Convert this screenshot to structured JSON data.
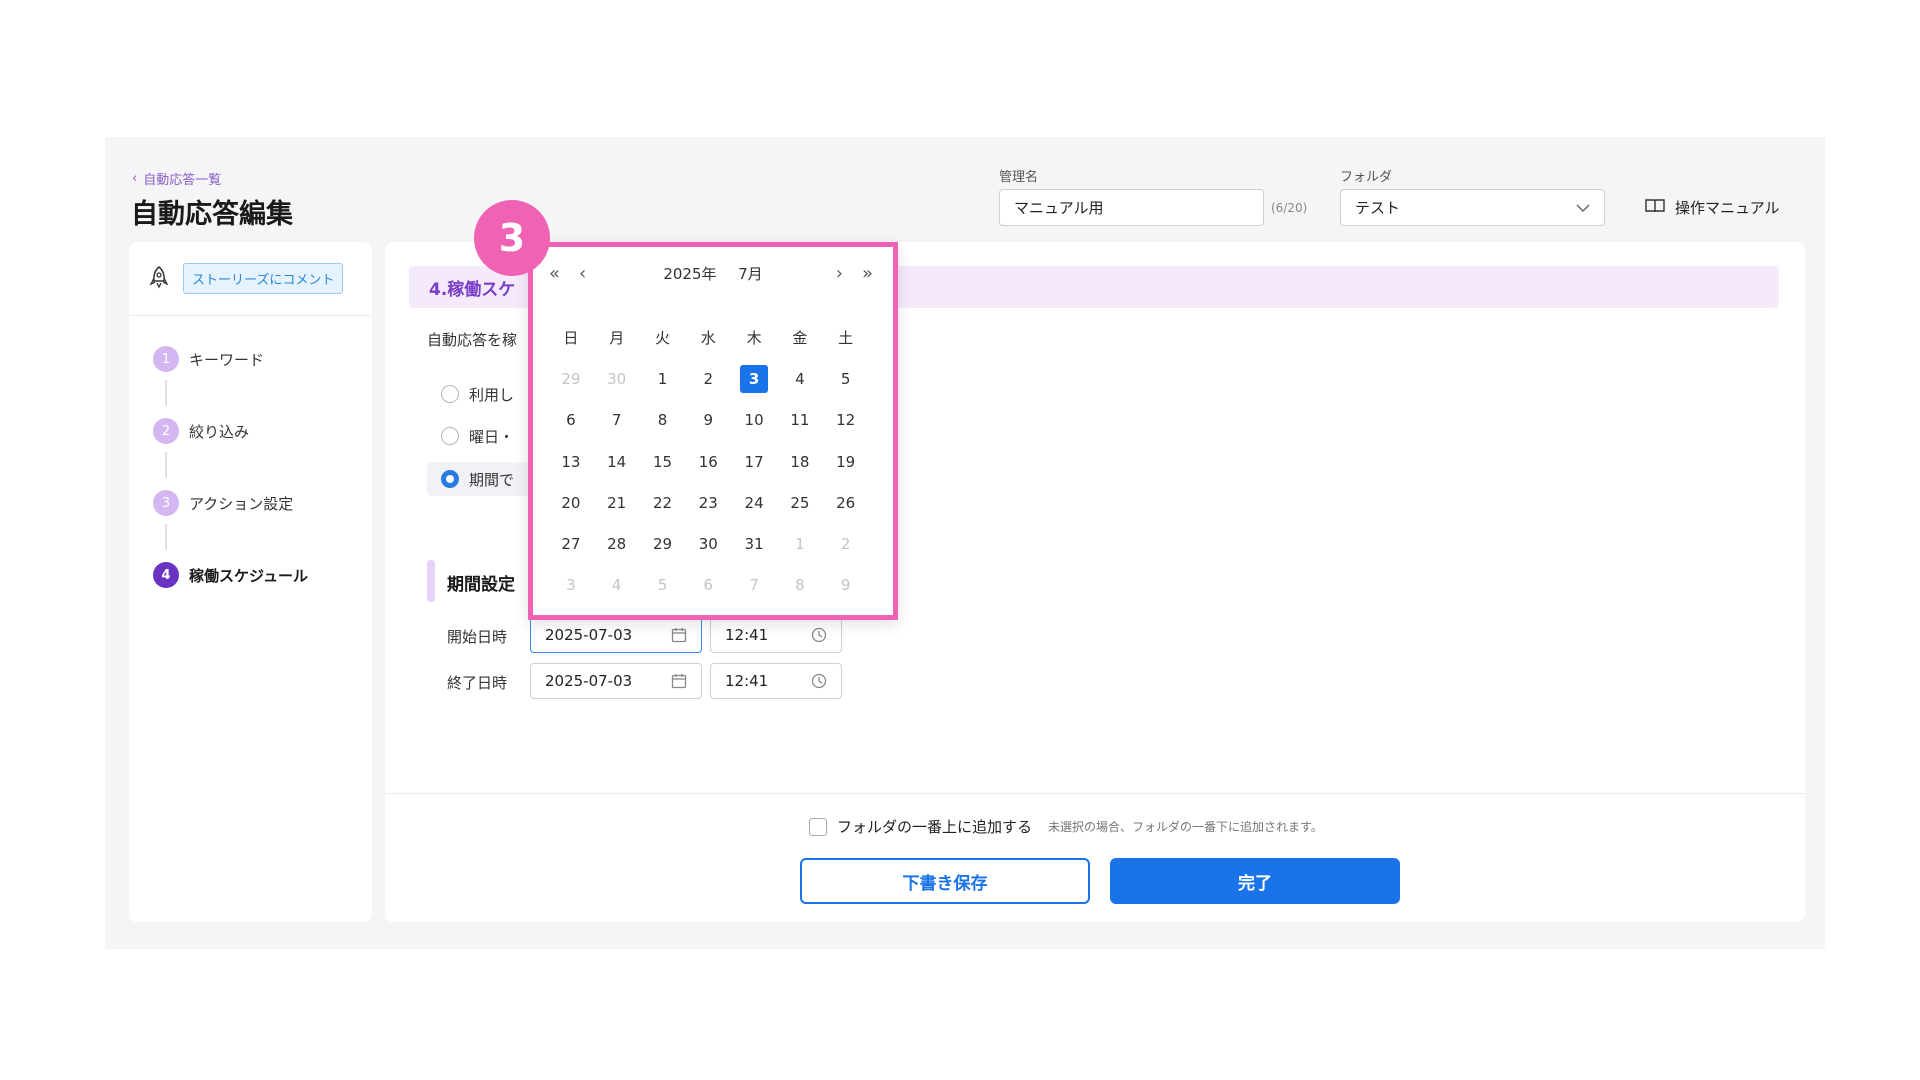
{
  "header": {
    "breadcrumb": "自動応答一覧",
    "title": "自動応答編集",
    "name_label": "管理名",
    "name_value": "マニュアル用",
    "name_counter": "(6/20)",
    "folder_label": "フォルダ",
    "folder_value": "テスト",
    "manual_link": "操作マニュアル"
  },
  "sidebar": {
    "chip": "ストーリーズにコメント",
    "steps": [
      {
        "num": "1",
        "label": "キーワード"
      },
      {
        "num": "2",
        "label": "絞り込み"
      },
      {
        "num": "3",
        "label": "アクション設定"
      },
      {
        "num": "4",
        "label": "稼働スケジュール"
      }
    ]
  },
  "main": {
    "section_title": "4.稼働スケ",
    "description": "自動応答を稼",
    "radios": [
      "利用し",
      "曜日・",
      "期間で"
    ],
    "period_title": "期間設定",
    "start_label": "開始日時",
    "start_date": "2025-07-03",
    "start_time": "12:41",
    "end_label": "終了日時",
    "end_date": "2025-07-03",
    "end_time": "12:41"
  },
  "footer": {
    "checkbox_label": "フォルダの一番上に追加する",
    "checkbox_note": "未選択の場合、フォルダの一番下に追加されます。",
    "draft_button": "下書き保存",
    "done_button": "完了"
  },
  "calendar": {
    "prev_year": "«",
    "prev_month": "‹",
    "year": "2025年",
    "month": "7月",
    "next_month": "›",
    "next_year": "»",
    "weekdays": [
      "日",
      "月",
      "火",
      "水",
      "木",
      "金",
      "土"
    ],
    "selected": "3",
    "days": [
      [
        "29",
        "30",
        "1",
        "2",
        "3",
        "4",
        "5"
      ],
      [
        "6",
        "7",
        "8",
        "9",
        "10",
        "11",
        "12"
      ],
      [
        "13",
        "14",
        "15",
        "16",
        "17",
        "18",
        "19"
      ],
      [
        "20",
        "21",
        "22",
        "23",
        "24",
        "25",
        "26"
      ],
      [
        "27",
        "28",
        "29",
        "30",
        "31",
        "1",
        "2"
      ],
      [
        "3",
        "4",
        "5",
        "6",
        "7",
        "8",
        "9"
      ]
    ]
  },
  "annotation": {
    "badge": "3",
    "color": "#f062b4"
  },
  "colors": {
    "primary": "#1a73e8",
    "accent": "#7a3fc9"
  }
}
